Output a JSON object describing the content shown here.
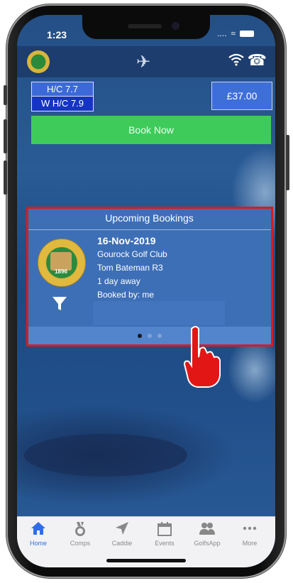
{
  "status_bar": {
    "time": "1:23",
    "signal": "....",
    "wifi": "wifi-icon"
  },
  "header": {
    "logo": "club-logo",
    "center_icon": "airplane-icon",
    "right_icons": [
      "wifi-icon",
      "phone-icon"
    ]
  },
  "handicap": {
    "hc": "H/C 7.7",
    "whc": "W H/C 7.9"
  },
  "balance": "£37.00",
  "book_button": "Book Now",
  "bookings": {
    "title": "Upcoming Bookings",
    "date": "16-Nov-2019",
    "club": "Gourock Golf Club",
    "player": "Tom Bateman R3",
    "days_away": "1 day away",
    "booked_by": "Booked by: me",
    "badge_text": "GOUROCK GOLF CLUB",
    "badge_year": "1896",
    "pages": 3,
    "active_page": 1
  },
  "tabs": [
    {
      "label": "Home",
      "icon": "home-icon",
      "active": true
    },
    {
      "label": "Comps",
      "icon": "medal-icon",
      "active": false
    },
    {
      "label": "Caddie",
      "icon": "navigation-icon",
      "active": false
    },
    {
      "label": "Events",
      "icon": "calendar-icon",
      "active": false
    },
    {
      "label": "GolfsApp",
      "icon": "people-icon",
      "active": false
    },
    {
      "label": "More",
      "icon": "more-icon",
      "active": false
    }
  ],
  "colors": {
    "accent": "#2f6ee8",
    "book": "#3ecb5a",
    "highlight": "#d81c1c"
  }
}
